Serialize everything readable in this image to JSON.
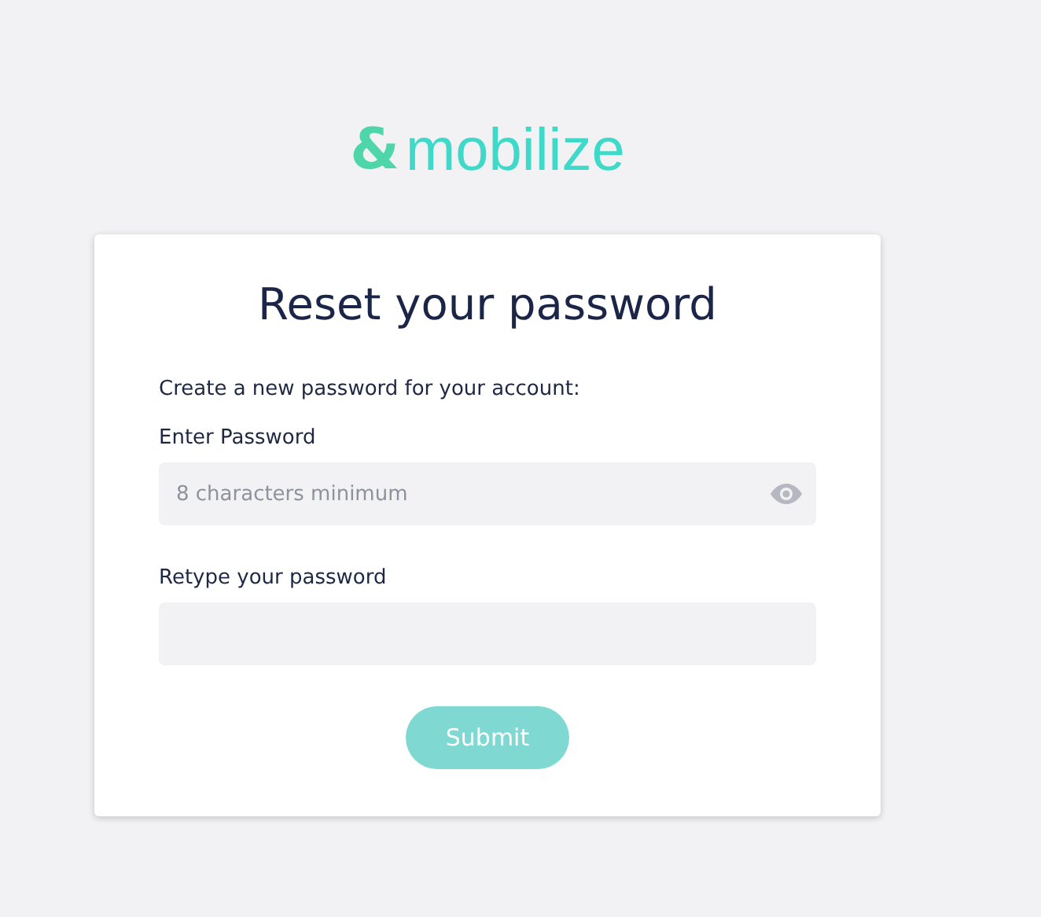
{
  "logo": {
    "mark": "&",
    "name": "mobilize"
  },
  "card": {
    "title": "Reset your password",
    "intro": "Create a new password for your account:",
    "fields": [
      {
        "label": "Enter Password",
        "placeholder": "8 characters minimum",
        "reveal": true
      },
      {
        "label": "Retype your password",
        "reveal": false
      }
    ],
    "submit": {
      "label": "Submit",
      "disabled": true
    }
  }
}
